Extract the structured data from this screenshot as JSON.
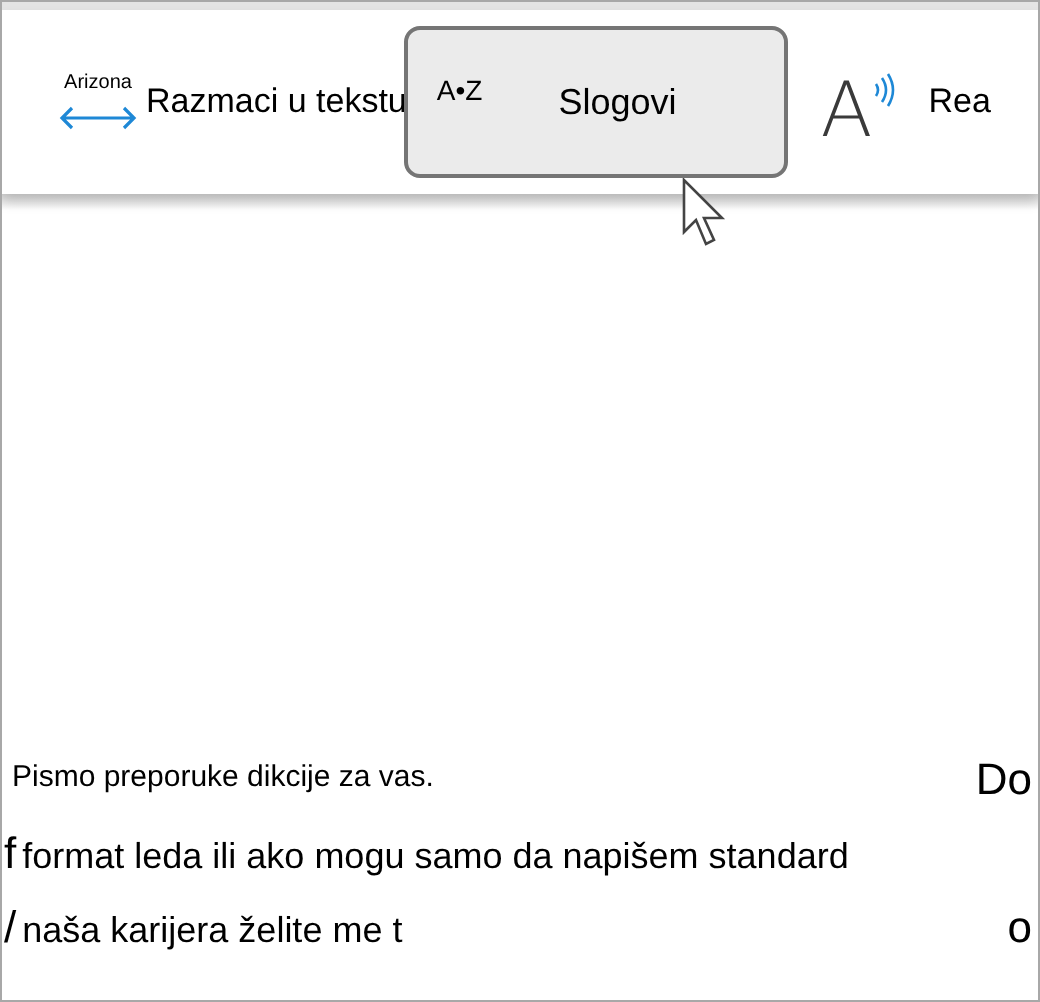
{
  "toolbar": {
    "items": [
      {
        "kind": "spacing",
        "icon_text": "Arizona",
        "label": "Razmaci u tekstu",
        "selected": false
      },
      {
        "kind": "syllables",
        "icon_text": "A•Z",
        "label": "Slogovi",
        "selected": true
      },
      {
        "kind": "read",
        "icon_text": "A",
        "label": "Rea",
        "selected": false
      }
    ]
  },
  "document": {
    "lines": [
      {
        "text": "Pismo preporuke dikcije za vas.",
        "right": "Do"
      },
      {
        "left": "f",
        "text": "format leda ili ako mogu samo da napišem standard"
      },
      {
        "left": "/",
        "text": "naša karijera želite me t",
        "right": "o"
      }
    ]
  }
}
